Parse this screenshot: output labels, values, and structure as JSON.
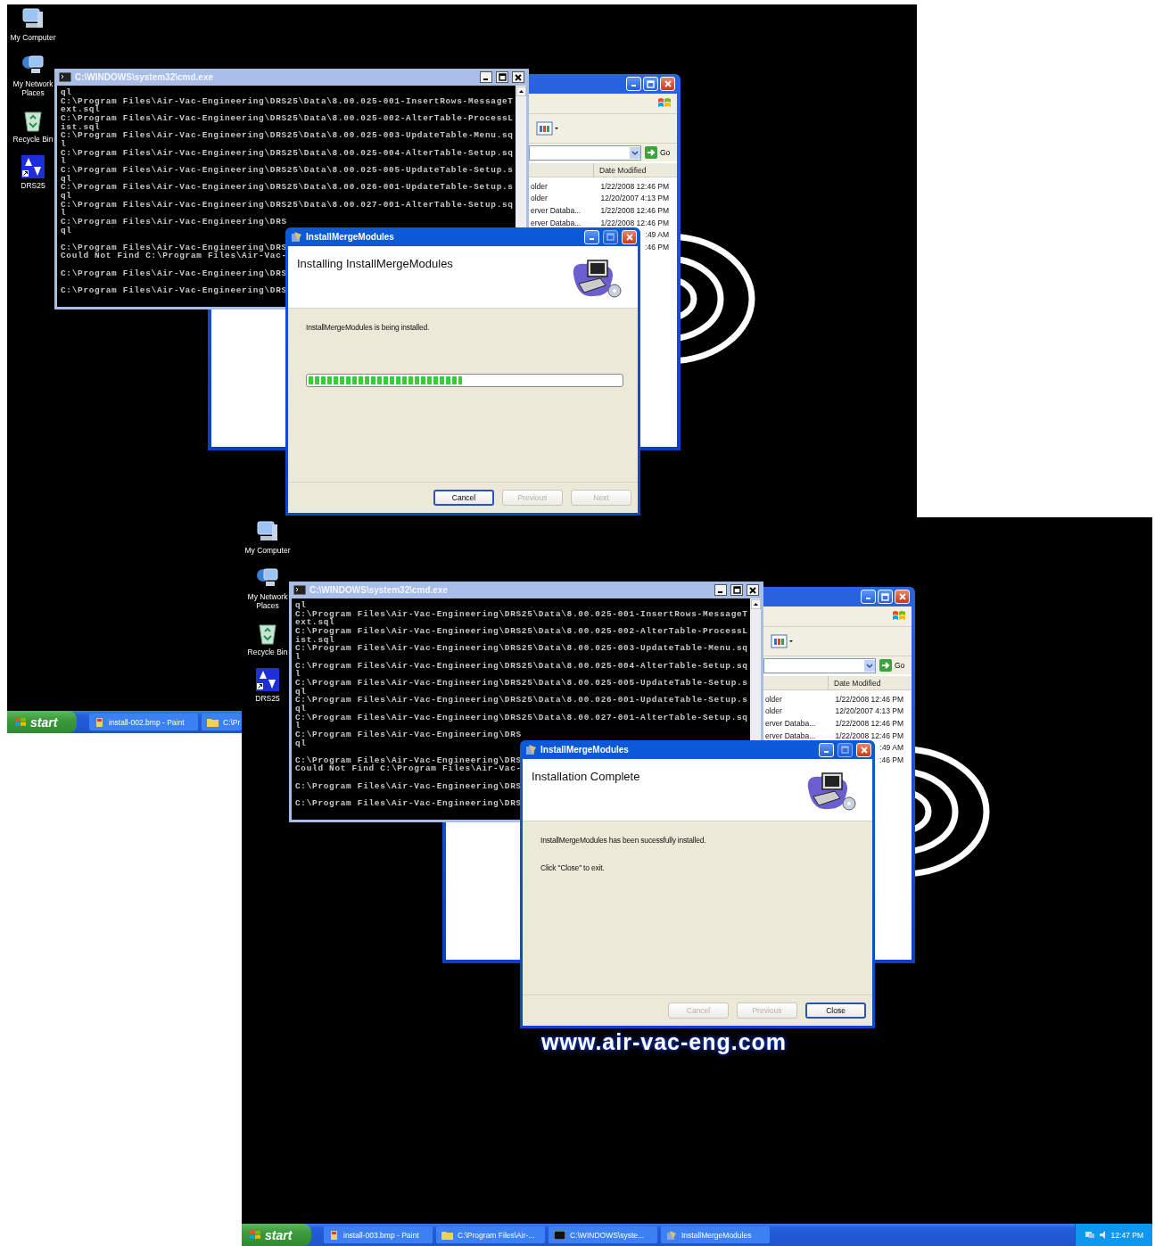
{
  "screenshots": [
    {
      "desktop_icons": [
        {
          "label": "My Computer",
          "kind": "computer"
        },
        {
          "label": "My Network Places",
          "kind": "network"
        },
        {
          "label": "Recycle Bin",
          "kind": "recycle"
        },
        {
          "label": "DRS25",
          "kind": "shortcut"
        }
      ],
      "console": {
        "title": "C:\\WINDOWS\\system32\\cmd.exe",
        "lines": [
          {
            "text": "ql"
          },
          {
            "text": "C:\\Program Files\\Air-Vac-Engineering\\DRS25\\Data\\8.00.025-001-InsertRows-MessageT"
          },
          {
            "text": "ext.sql"
          },
          {
            "text": "C:\\Program Files\\Air-Vac-Engineering\\DRS25\\Data\\8.00.025-002-AlterTable-ProcessL"
          },
          {
            "text": "ist.sql"
          },
          {
            "text": "C:\\Program Files\\Air-Vac-Engineering\\DRS25\\Data\\8.00.025-003-UpdateTable-Menu.sq"
          },
          {
            "text": "l"
          },
          {
            "text": "C:\\Program Files\\Air-Vac-Engineering\\DRS25\\Data\\8.00.025-004-AlterTable-Setup.sq"
          },
          {
            "text": "l"
          },
          {
            "text": "C:\\Program Files\\Air-Vac-Engineering\\DRS25\\Data\\8.00.025-005-UpdateTable-Setup.s"
          },
          {
            "text": "ql"
          },
          {
            "text": "C:\\Program Files\\Air-Vac-Engineering\\DRS25\\Data\\8.00.026-001-UpdateTable-Setup.s"
          },
          {
            "text": "ql"
          },
          {
            "text": "C:\\Program Files\\Air-Vac-Engineering\\DRS25\\Data\\8.00.027-001-AlterTable-Setup.sq"
          },
          {
            "text": "l"
          },
          {
            "text": "C:\\Program Files\\Air-Vac-Engineering\\DRS"
          },
          {
            "text": "ql"
          },
          {
            "text": "C:\\Program Files\\Air-Vac-Engineering\\DRS",
            "gap_before": true
          },
          {
            "text": "Could Not Find C:\\Program Files\\Air-Vac-"
          },
          {
            "text": "C:\\Program Files\\Air-Vac-Engineering\\DRS",
            "gap_before": true
          },
          {
            "text": "C:\\Program Files\\Air-Vac-Engineering\\DRS",
            "gap_before": true
          }
        ]
      },
      "explorer": {
        "date_header": "Date Modified",
        "go_label": "Go",
        "rows": [
          {
            "column_1": "older",
            "date_modified": "1/22/2008 12:46 PM"
          },
          {
            "column_1": "older",
            "date_modified": "12/20/2007 4:13 PM"
          },
          {
            "column_1": "erver Databa...",
            "date_modified": "1/22/2008 12:46 PM"
          },
          {
            "column_1": "erver Databa...",
            "date_modified": "1/22/2008 12:46 PM"
          },
          {
            "date_modified": ":49 AM"
          },
          {
            "date_modified": ":46 PM"
          }
        ]
      },
      "installer": {
        "title": "InstallMergeModules",
        "heading": "Installing InstallMergeModules",
        "messages": [
          "InstallMergeModules is being installed."
        ],
        "progress": {
          "level": 0.49
        },
        "buttons": [
          {
            "label": "Cancel",
            "disabled": false,
            "default": true
          },
          {
            "label": "Previous",
            "disabled": true,
            "default": false
          },
          {
            "label": "Next",
            "disabled": true,
            "default": false
          }
        ]
      },
      "taskbar": {
        "start_label": "start",
        "items": [
          {
            "label": "install-002.bmp - Paint",
            "kind": "paint"
          },
          {
            "label": "C:\\Pr",
            "kind": "folder"
          }
        ]
      }
    },
    {
      "desktop_icons": [
        {
          "label": "My Computer",
          "kind": "computer"
        },
        {
          "label": "My Network Places",
          "kind": "network"
        },
        {
          "label": "Recycle Bin",
          "kind": "recycle"
        },
        {
          "label": "DRS25",
          "kind": "shortcut"
        }
      ],
      "console": {
        "title": "C:\\WINDOWS\\system32\\cmd.exe",
        "lines": [
          {
            "text": "ql"
          },
          {
            "text": "C:\\Program Files\\Air-Vac-Engineering\\DRS25\\Data\\8.00.025-001-InsertRows-MessageT"
          },
          {
            "text": "ext.sql"
          },
          {
            "text": "C:\\Program Files\\Air-Vac-Engineering\\DRS25\\Data\\8.00.025-002-AlterTable-ProcessL"
          },
          {
            "text": "ist.sql"
          },
          {
            "text": "C:\\Program Files\\Air-Vac-Engineering\\DRS25\\Data\\8.00.025-003-UpdateTable-Menu.sq"
          },
          {
            "text": "l"
          },
          {
            "text": "C:\\Program Files\\Air-Vac-Engineering\\DRS25\\Data\\8.00.025-004-AlterTable-Setup.sq"
          },
          {
            "text": "l"
          },
          {
            "text": "C:\\Program Files\\Air-Vac-Engineering\\DRS25\\Data\\8.00.025-005-UpdateTable-Setup.s"
          },
          {
            "text": "ql"
          },
          {
            "text": "C:\\Program Files\\Air-Vac-Engineering\\DRS25\\Data\\8.00.026-001-UpdateTable-Setup.s"
          },
          {
            "text": "ql"
          },
          {
            "text": "C:\\Program Files\\Air-Vac-Engineering\\DRS25\\Data\\8.00.027-001-AlterTable-Setup.sq"
          },
          {
            "text": "l"
          },
          {
            "text": "C:\\Program Files\\Air-Vac-Engineering\\DRS"
          },
          {
            "text": "ql"
          },
          {
            "text": "C:\\Program Files\\Air-Vac-Engineering\\DRS",
            "gap_before": true
          },
          {
            "text": "Could Not Find C:\\Program Files\\Air-Vac-"
          },
          {
            "text": "C:\\Program Files\\Air-Vac-Engineering\\DRS",
            "gap_before": true
          },
          {
            "text": "C:\\Program Files\\Air-Vac-Engineering\\DRS",
            "gap_before": true
          }
        ]
      },
      "explorer": {
        "date_header": "Date Modified",
        "go_label": "Go",
        "rows": [
          {
            "column_1": "older",
            "date_modified": "1/22/2008 12:46 PM"
          },
          {
            "column_1": "older",
            "date_modified": "12/20/2007 4:13 PM"
          },
          {
            "column_1": "erver Databa...",
            "date_modified": "1/22/2008 12:46 PM"
          },
          {
            "column_1": "erver Databa...",
            "date_modified": "1/22/2008 12:46 PM"
          },
          {
            "date_modified": ":49 AM"
          },
          {
            "date_modified": ":46 PM"
          }
        ]
      },
      "installer": {
        "title": "InstallMergeModules",
        "heading": "Installation Complete",
        "messages": [
          "InstallMergeModules has been sucessfully installed.",
          "Click \"Close\" to exit."
        ],
        "buttons": [
          {
            "label": "Cancel",
            "disabled": true,
            "default": false
          },
          {
            "label": "Previous",
            "disabled": true,
            "default": false
          },
          {
            "label": "Close",
            "disabled": false,
            "default": true
          }
        ]
      },
      "wallpaper_text": "www.air-vac-eng.com",
      "taskbar": {
        "start_label": "start",
        "items": [
          {
            "label": "install-003.bmp - Paint",
            "kind": "paint"
          },
          {
            "label": "C:\\Program Files\\Air-...",
            "kind": "folder"
          },
          {
            "label": "C:\\WINDOWS\\syste...",
            "kind": "console"
          },
          {
            "label": "InstallMergeModules",
            "kind": "installer"
          }
        ],
        "clock": "12:47 PM"
      }
    }
  ]
}
